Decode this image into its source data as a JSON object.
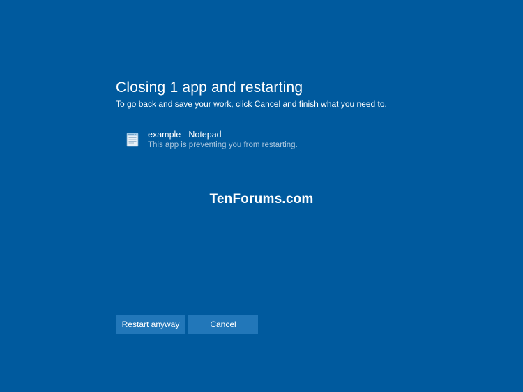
{
  "heading": "Closing 1 app and restarting",
  "subheading": "To go back and save your work, click Cancel and finish what you need to.",
  "app": {
    "name": "example - Notepad",
    "status": "This app is preventing you from restarting."
  },
  "buttons": {
    "restart": "Restart anyway",
    "cancel": "Cancel"
  },
  "watermark": "TenForums.com"
}
